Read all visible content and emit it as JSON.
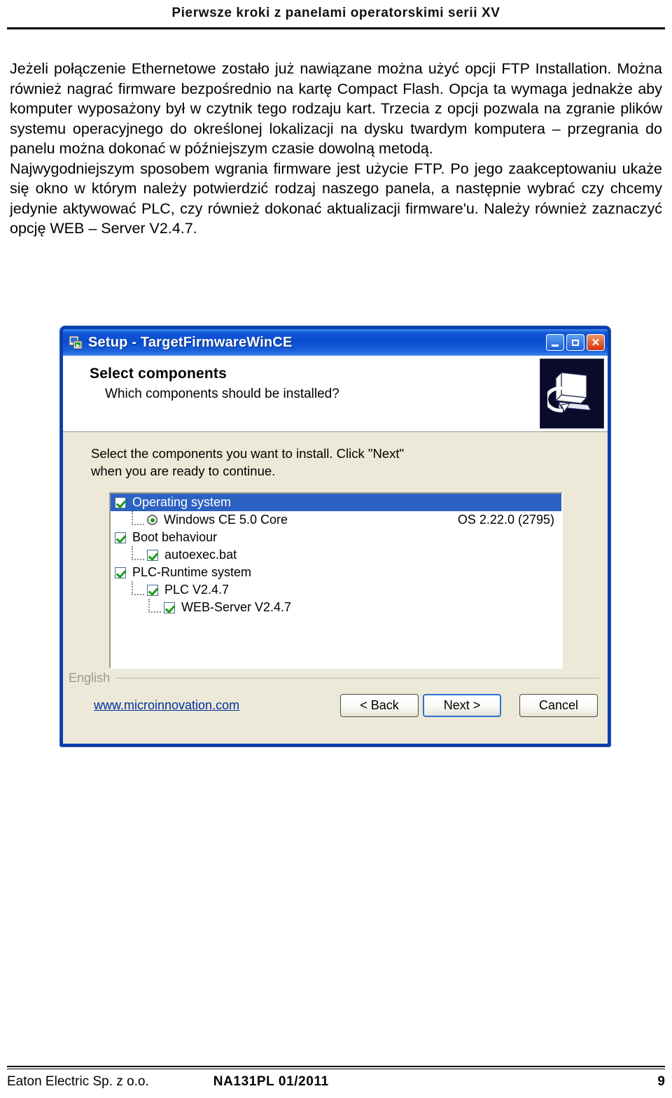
{
  "page": {
    "header_title": "Pierwsze kroki z panelami operatorskimi serii XV",
    "paragraphs": [
      "Jeżeli połączenie Ethernetowe zostało już nawiązane można użyć opcji FTP Installation. Można również nagrać firmware bezpośrednio na kartę Compact Flash. Opcja ta wymaga jednakże aby komputer wyposażony był w czytnik tego rodzaju kart. Trzecia z opcji pozwala na zgranie plików systemu operacyjnego do określonej lokalizacji na dysku twardym komputera – przegrania do panelu można dokonać w późniejszym czasie dowolną metodą.",
      "Najwygodniejszym sposobem wgrania firmware jest użycie FTP. Po jego zaakceptowaniu ukaże się okno w którym należy potwierdzić rodzaj naszego panela, a następnie wybrać czy chcemy jedynie aktywować PLC, czy również dokonać aktualizacji firmware'u. Należy również zaznaczyć opcję WEB – Server V2.4.7."
    ],
    "footer": {
      "left": "Eaton Electric Sp. z o.o.",
      "center": "NA131PL 01/2011",
      "page_number": "9"
    }
  },
  "dialog": {
    "title": "Setup - TargetFirmwareWinCE",
    "titlebar_icon": "setup-monitor-icon",
    "window_buttons": [
      {
        "name": "minimize-button",
        "glyph": "–"
      },
      {
        "name": "maximize-button",
        "glyph": "▢"
      },
      {
        "name": "close-button",
        "glyph": "✕"
      }
    ],
    "heading": "Select components",
    "subheading": "Which components should be installed?",
    "banner_icon": "install-computer-icon",
    "instruction_line1": "Select the components you want to install. Click \"Next\"",
    "instruction_line2": "when you are ready to continue.",
    "tree": [
      {
        "label": "Operating system",
        "control": "checkbox",
        "checked": true,
        "indent": 0,
        "selected": true,
        "version": ""
      },
      {
        "label": "Windows CE 5.0 Core",
        "control": "radio",
        "checked": true,
        "indent": 1,
        "selected": false,
        "version": "OS 2.22.0 (2795)"
      },
      {
        "label": "Boot behaviour",
        "control": "checkbox",
        "checked": true,
        "indent": 0,
        "selected": false,
        "version": ""
      },
      {
        "label": "autoexec.bat",
        "control": "checkbox",
        "checked": true,
        "indent": 1,
        "selected": false,
        "version": ""
      },
      {
        "label": "PLC-Runtime system",
        "control": "checkbox",
        "checked": true,
        "indent": 0,
        "selected": false,
        "version": ""
      },
      {
        "label": "PLC V2.4.7",
        "control": "checkbox",
        "checked": true,
        "indent": 1,
        "selected": false,
        "version": ""
      },
      {
        "label": "WEB-Server V2.4.7",
        "control": "checkbox",
        "checked": true,
        "indent": 2,
        "selected": false,
        "version": ""
      }
    ],
    "language_label": "English",
    "weblink": "www.microinnovation.com",
    "buttons": {
      "back": "< Back",
      "next": "Next >",
      "cancel": "Cancel"
    },
    "colors": {
      "titlebar_blue": "#0A4BD0",
      "window_frame": "#0A3FAF",
      "dialog_bg": "#ECE9D8",
      "selection_blue": "#2C62C1",
      "check_green": "#1A9B1A",
      "link_blue": "#00309B",
      "banner_bg": "#0A0A2A"
    }
  }
}
